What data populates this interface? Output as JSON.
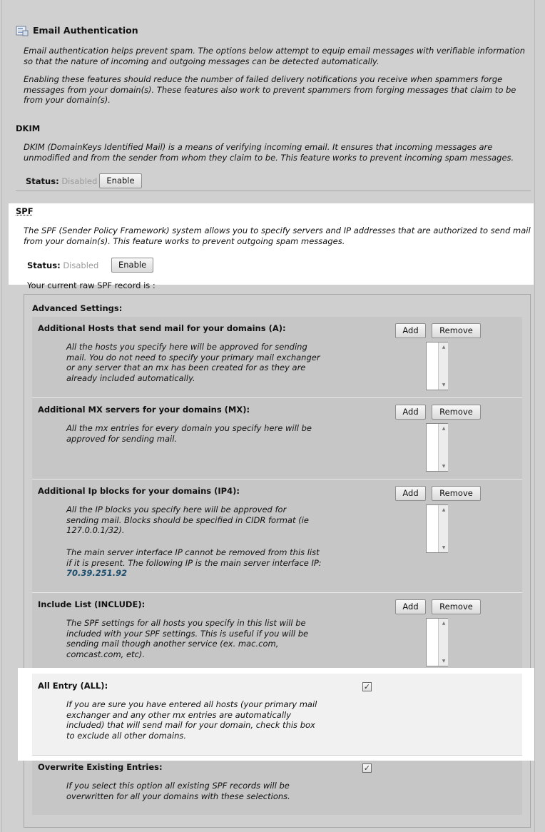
{
  "email_auth": {
    "title": "Email Authentication",
    "p1": "Email authentication helps prevent spam. The options below attempt to equip email messages with verifiable information so that the nature of incoming and outgoing messages can be detected automatically.",
    "p2": "Enabling these features should reduce the number of failed delivery notifications you receive when spammers forge messages from your domain(s). These features also work to prevent spammers from forging messages that claim to be from your domain(s)."
  },
  "dkim": {
    "heading": "DKIM",
    "desc": "DKIM (DomainKeys Identified Mail) is a means of verifying incoming email. It ensures that incoming messages are unmodified and from the sender from whom they claim to be. This feature works to prevent incoming spam messages.",
    "status_label": "Status:",
    "status_value": "Disabled",
    "enable_label": "Enable"
  },
  "spf": {
    "heading": "SPF",
    "desc": "The SPF (Sender Policy Framework) system allows you to specify servers and IP addresses that are authorized to send mail from your domain(s). This feature works to prevent outgoing spam messages.",
    "status_label": "Status:",
    "status_value": "Disabled",
    "enable_label": "Enable",
    "raw_record_label": "Your current raw SPF record is :"
  },
  "advanced": {
    "heading": "Advanced Settings:",
    "add_label": "Add",
    "remove_label": "Remove",
    "hosts": {
      "title": "Additional Hosts that send mail for your domains (A):",
      "desc": "All the hosts you specify here will be approved for sending mail. You do not need to specify your primary mail exchanger or any server that an mx has been created for as they are already included automatically."
    },
    "mx": {
      "title": "Additional MX servers for your domains (MX):",
      "desc": "All the mx entries for every domain you specify here will be approved for sending mail."
    },
    "ip4": {
      "title": "Additional Ip blocks for your domains (IP4):",
      "desc1": "All the IP blocks you specify here will be approved for sending mail. Blocks should be specified in CIDR format (ie 127.0.0.1/32).",
      "desc2": "The main server interface IP cannot be removed from this list if it is present. The following IP is the main server interface IP:",
      "ip": "70.39.251.92"
    },
    "include": {
      "title": "Include List (INCLUDE):",
      "desc": "The SPF settings for all hosts you specify in this list will be included with your SPF settings. This is useful if you will be sending mail though another service (ex. mac.com, comcast.com, etc)."
    },
    "all": {
      "title": "All Entry (ALL):",
      "desc": "If you are sure you have entered all hosts (your primary mail exchanger and any other mx entries are automatically included) that will send mail for your domain, check this box to exclude all other domains.",
      "checked": true
    },
    "overwrite": {
      "title": "Overwrite Existing Entries:",
      "desc": "If you select this option all existing SPF records will be overwritten for all your domains with these selections.",
      "checked": true
    }
  },
  "colors": {
    "background": "#d0d0d0",
    "highlight": "#ffffff",
    "ip_link": "#1d4f6e",
    "disabled_text": "#9a9a9a"
  },
  "icons": {
    "section_icon": "email-auth-icon",
    "check": "checkmark"
  }
}
